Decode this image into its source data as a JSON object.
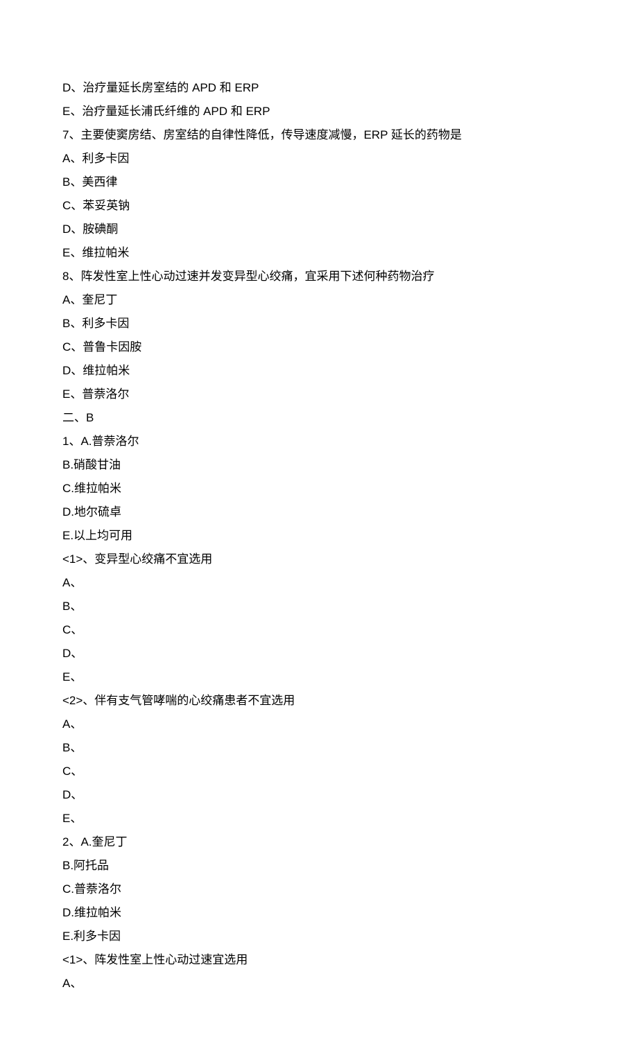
{
  "lines": [
    "D、治疗量延长房室结的 APD 和 ERP",
    "E、治疗量延长浦氏纤维的 APD 和 ERP",
    "7、主要使窦房结、房室结的自律性降低，传导速度减慢，ERP 延长的药物是",
    "A、利多卡因",
    "B、美西律",
    "C、苯妥英钠",
    "D、胺碘酮",
    "E、维拉帕米",
    "8、阵发性室上性心动过速并发变异型心绞痛，宜采用下述何种药物治疗",
    "A、奎尼丁",
    "B、利多卡因",
    "C、普鲁卡因胺",
    "D、维拉帕米",
    "E、普萘洛尔",
    "二、B",
    "1、A.普萘洛尔",
    "B.硝酸甘油",
    "C.维拉帕米",
    "D.地尔硫卓",
    "E.以上均可用",
    "<1>、变异型心绞痛不宜选用",
    "A、",
    "B、",
    "C、",
    "D、",
    "E、",
    "<2>、伴有支气管哮喘的心绞痛患者不宜选用",
    "A、",
    "B、",
    "C、",
    "D、",
    "E、",
    "2、A.奎尼丁",
    "B.阿托品",
    "C.普萘洛尔",
    "D.维拉帕米",
    "E.利多卡因",
    "<1>、阵发性室上性心动过速宜选用",
    "A、"
  ]
}
